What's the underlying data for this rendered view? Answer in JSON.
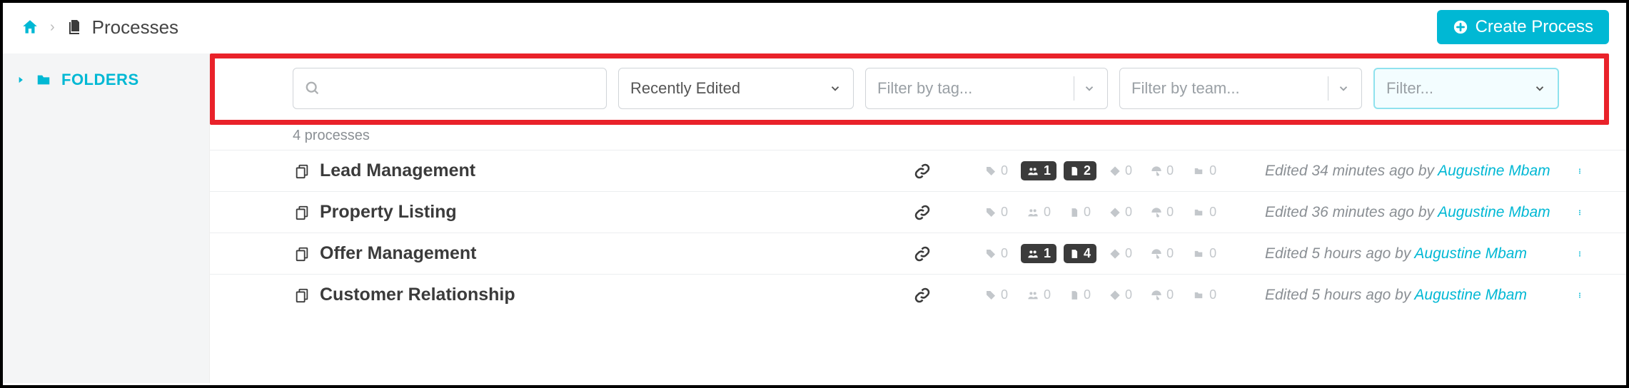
{
  "breadcrumb": {
    "page_title": "Processes"
  },
  "header": {
    "create_button": "Create Process"
  },
  "sidebar": {
    "folders_label": "FOLDERS"
  },
  "filters": {
    "sort_label": "Recently Edited",
    "tag_placeholder": "Filter by tag...",
    "team_placeholder": "Filter by team...",
    "extra_placeholder": "Filter..."
  },
  "list": {
    "count_text": "4 processes",
    "edited_prefix": "Edited ",
    "by_text": " by ",
    "items": [
      {
        "title": "Lead Management",
        "tag": "0",
        "people": "1",
        "file": "2",
        "diamond": "0",
        "umbrella": "0",
        "folder": "0",
        "people_active": true,
        "file_active": true,
        "edited_ago": "34 minutes ago",
        "author": "Augustine Mbam"
      },
      {
        "title": "Property Listing",
        "tag": "0",
        "people": "0",
        "file": "0",
        "diamond": "0",
        "umbrella": "0",
        "folder": "0",
        "people_active": false,
        "file_active": false,
        "edited_ago": "36 minutes ago",
        "author": "Augustine Mbam"
      },
      {
        "title": "Offer Management",
        "tag": "0",
        "people": "1",
        "file": "4",
        "diamond": "0",
        "umbrella": "0",
        "folder": "0",
        "people_active": true,
        "file_active": true,
        "edited_ago": "5 hours ago",
        "author": "Augustine Mbam"
      },
      {
        "title": "Customer Relationship",
        "tag": "0",
        "people": "0",
        "file": "0",
        "diamond": "0",
        "umbrella": "0",
        "folder": "0",
        "people_active": false,
        "file_active": false,
        "edited_ago": "5 hours ago",
        "author": "Augustine Mbam"
      }
    ]
  }
}
